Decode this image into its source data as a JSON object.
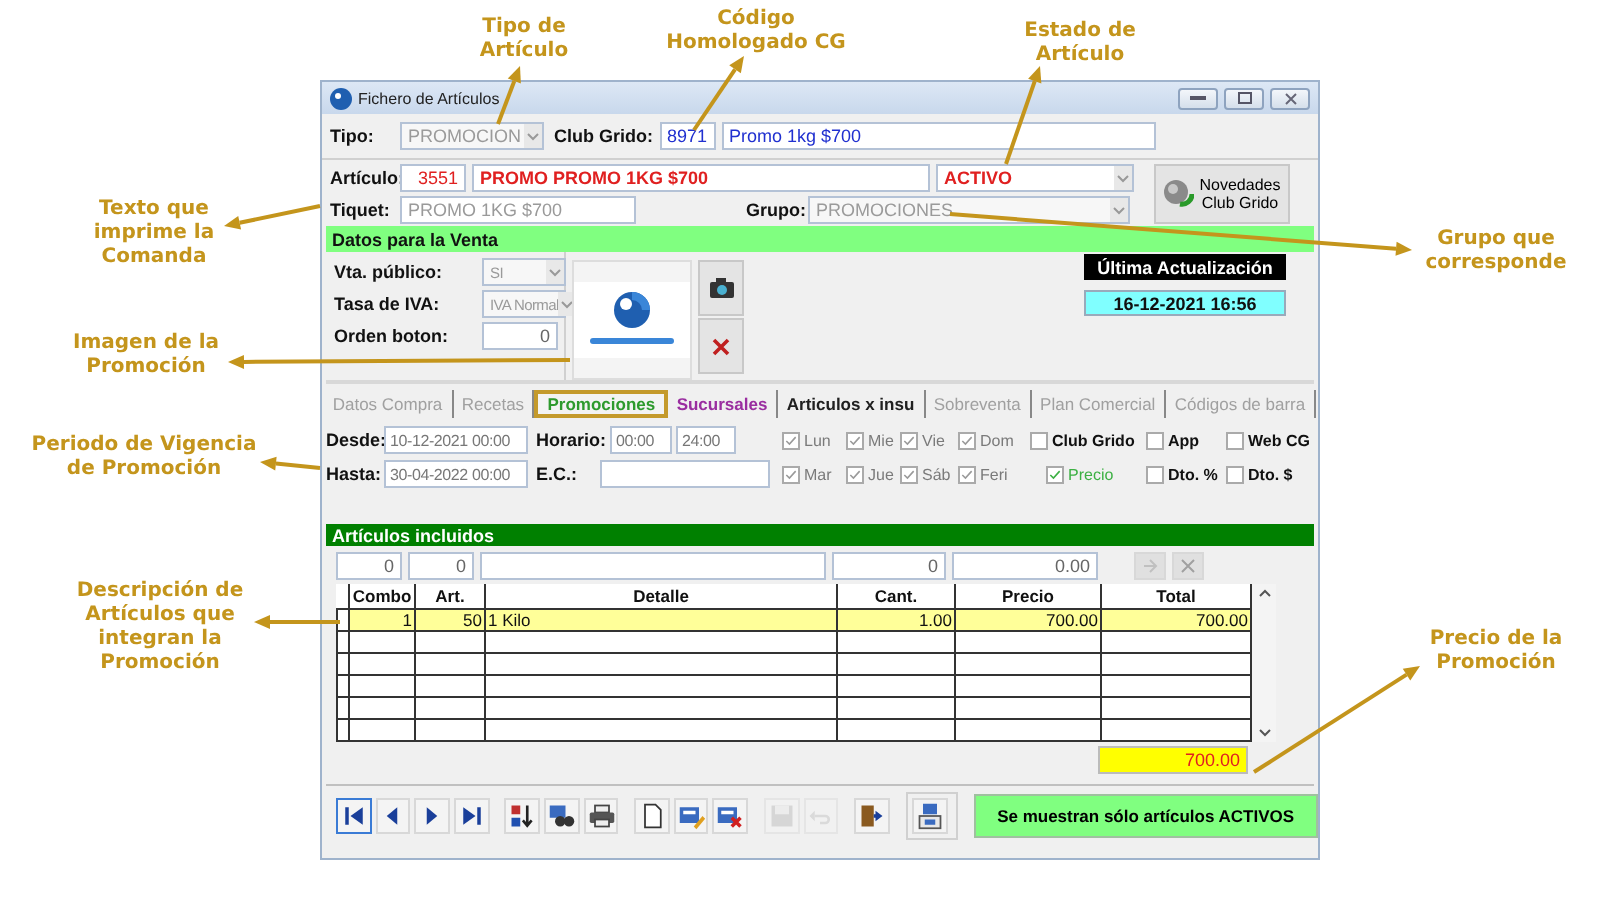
{
  "annotations": [
    {
      "text": "Tipo de\nArtículo"
    },
    {
      "text": "Código\nHomologado CG"
    },
    {
      "text": "Estado de\nArtículo"
    },
    {
      "text": "Texto que\nimprime la\nComanda"
    },
    {
      "text": "Grupo que\ncorresponde"
    },
    {
      "text": "Imagen de la\nPromoción"
    },
    {
      "text": "Periodo de Vigencia\nde Promoción"
    },
    {
      "text": "Descripción de\nArtículos que\nintegran la\nPromoción"
    },
    {
      "text": "Precio de la\nPromoción"
    }
  ],
  "window": {
    "title": "Fichero de Artículos"
  },
  "header": {
    "tipo": {
      "label": "Tipo:",
      "value": "PROMOCION"
    },
    "club_grido": {
      "label": "Club Grido:",
      "code": "8971",
      "name": "Promo 1kg $700"
    },
    "articulo": {
      "label": "Artículo:",
      "code": "3551",
      "name": "PROMO PROMO 1KG $700",
      "status": "ACTIVO"
    },
    "tiquet": {
      "label": "Tiquet:",
      "value": "PROMO 1KG $700"
    },
    "grupo": {
      "label": "Grupo:",
      "value": "PROMOCIONES"
    },
    "novedades_button": "Novedades\nClub Grido"
  },
  "venta": {
    "title": "Datos para la Venta",
    "fields": [
      {
        "label": "Vta. público:",
        "value": "SI",
        "kind": "dropdown"
      },
      {
        "label": "Tasa de IVA:",
        "value": "IVA Normal",
        "kind": "dropdown"
      },
      {
        "label": "Orden boton:",
        "value": "0",
        "kind": "number"
      }
    ],
    "last_update": {
      "label": "Última Actualización",
      "value": "16-12-2021 16:56"
    }
  },
  "tabs": [
    {
      "label": "Datos Compra",
      "selected": false,
      "disabled": true,
      "color": "#a0a0a0"
    },
    {
      "label": "Recetas",
      "selected": false,
      "disabled": true,
      "color": "#a0a0a0"
    },
    {
      "label": "Promociones",
      "selected": true,
      "disabled": false,
      "color": "#2e9a2e"
    },
    {
      "label": "Sucursales",
      "selected": false,
      "disabled": false,
      "color": "#9a2ea0"
    },
    {
      "label": "Articulos x insu",
      "selected": false,
      "disabled": false,
      "color": "#202020"
    },
    {
      "label": "Sobreventa",
      "selected": false,
      "disabled": true,
      "color": "#a0a0a0"
    },
    {
      "label": "Plan Comercial",
      "selected": false,
      "disabled": true,
      "color": "#a0a0a0"
    },
    {
      "label": "Códigos de barra",
      "selected": false,
      "disabled": true,
      "color": "#a0a0a0"
    }
  ],
  "vigencia": {
    "desde": {
      "label": "Desde:",
      "value": "10-12-2021 00:00"
    },
    "hasta": {
      "label": "Hasta:",
      "value": "30-04-2022 00:00"
    },
    "horario": {
      "label": "Horario:",
      "from": "00:00",
      "to": "24:00"
    },
    "ec": {
      "label": "E.C.:"
    }
  },
  "checkbox_rows": [
    [
      {
        "label": "Lun",
        "checked": true,
        "kind": "day"
      },
      {
        "label": "Mie",
        "checked": true,
        "kind": "day"
      },
      {
        "label": "Vie",
        "checked": true,
        "kind": "day"
      },
      {
        "label": "Dom",
        "checked": true,
        "kind": "day"
      },
      {
        "label": "Club Grido",
        "checked": false,
        "kind": "option"
      },
      {
        "label": "App",
        "checked": false,
        "kind": "option"
      },
      {
        "label": "Web CG",
        "checked": false,
        "kind": "option"
      }
    ],
    [
      {
        "label": "Mar",
        "checked": true,
        "kind": "day"
      },
      {
        "label": "Jue",
        "checked": true,
        "kind": "day"
      },
      {
        "label": "Sáb",
        "checked": true,
        "kind": "day"
      },
      {
        "label": "Feri",
        "checked": true,
        "kind": "day"
      },
      {
        "label": "Precio",
        "checked": true,
        "kind": "price"
      },
      {
        "label": "Dto. %",
        "checked": false,
        "kind": "option"
      },
      {
        "label": "Dto. $",
        "checked": false,
        "kind": "option"
      }
    ]
  ],
  "articulos_incluidos": {
    "title": "Artículos incluidos",
    "entry_fields": [
      {
        "kind": "number",
        "value": "0"
      },
      {
        "kind": "number",
        "value": "0"
      },
      {
        "kind": "text"
      },
      {
        "kind": "number",
        "value": "0"
      },
      {
        "kind": "number",
        "value": "0.00"
      }
    ],
    "table": {
      "columns": [
        "Combo",
        "Art.",
        "Detalle",
        "Cant.",
        "Precio",
        "Total"
      ],
      "rows": [
        {
          "cells": [
            "1",
            "50",
            "1 Kilo",
            "1.00",
            "700.00",
            "700.00"
          ],
          "selected": true
        }
      ]
    },
    "total": "700.00"
  },
  "toolbar": [
    {
      "kind": "first",
      "disabled": false
    },
    {
      "kind": "prev",
      "disabled": false
    },
    {
      "kind": "next",
      "disabled": false
    },
    {
      "kind": "last",
      "disabled": false
    },
    {
      "kind": "sort",
      "disabled": false
    },
    {
      "kind": "find",
      "disabled": false
    },
    {
      "kind": "print",
      "disabled": false
    },
    {
      "kind": "new",
      "disabled": false
    },
    {
      "kind": "edit",
      "disabled": false
    },
    {
      "kind": "delete",
      "disabled": false
    },
    {
      "kind": "save",
      "disabled": true
    },
    {
      "kind": "undo",
      "disabled": true
    },
    {
      "kind": "exit",
      "disabled": false
    },
    {
      "kind": "panel",
      "disabled": false
    }
  ],
  "status_button": "Se muestran sólo artículos ACTIVOS"
}
